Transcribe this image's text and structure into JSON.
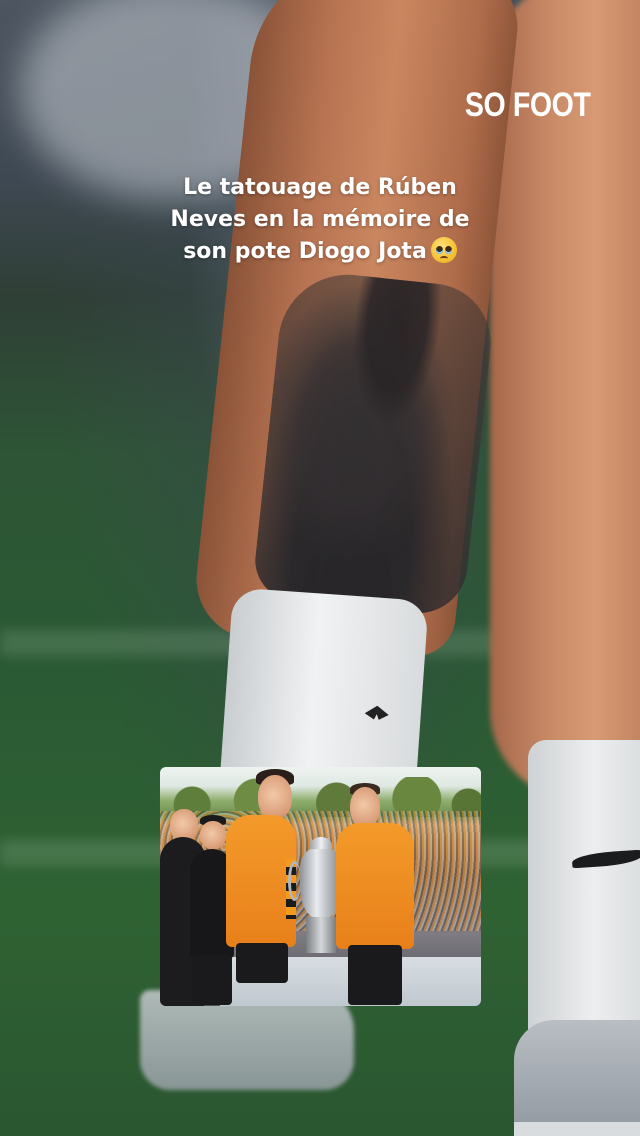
{
  "brand": {
    "logo_text": "SO FOOT"
  },
  "caption": {
    "line1": "Le tatouage de Rúben",
    "line2": "Neves en la mémoire de",
    "line3": "son pote Diogo Jota",
    "emoji": "pleading-face"
  },
  "inset_photo": {
    "description_icon": "photo"
  },
  "colors": {
    "pitch_green": "#2e5a34",
    "jersey_orange": "#f08a22",
    "text_white": "#ffffff"
  }
}
